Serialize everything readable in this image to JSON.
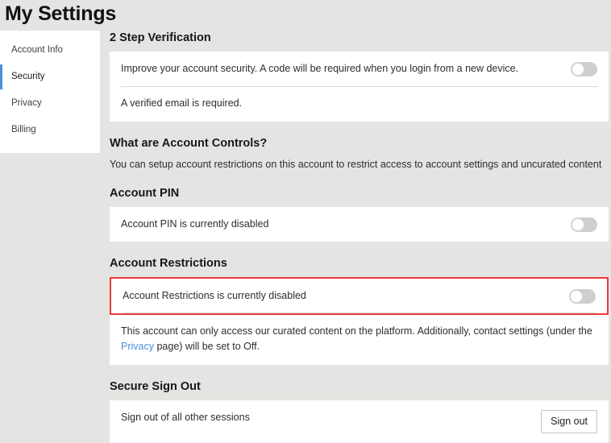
{
  "page": {
    "title": "My Settings",
    "background_color": "#e4e4e2",
    "accent_color": "#4a90d9",
    "highlight_color": "#ef3b3b"
  },
  "sidebar": {
    "items": [
      {
        "label": "Account Info",
        "active": false
      },
      {
        "label": "Security",
        "active": true
      },
      {
        "label": "Privacy",
        "active": false
      },
      {
        "label": "Billing",
        "active": false
      }
    ]
  },
  "sections": {
    "two_step": {
      "heading": "2 Step Verification",
      "row_text": "Improve your account security. A code will be required when you login from a new device.",
      "toggle_state": "off",
      "note": "A verified email is required."
    },
    "account_controls": {
      "heading": "What are Account Controls?",
      "description": "You can setup account restrictions on this account to restrict access to account settings and uncurated content"
    },
    "account_pin": {
      "heading": "Account PIN",
      "row_text": "Account PIN is currently disabled",
      "toggle_state": "off"
    },
    "account_restrictions": {
      "heading": "Account Restrictions",
      "row_text": "Account Restrictions is currently disabled",
      "toggle_state": "off",
      "note_before_link": "This account can only access our curated content on the platform. Additionally, contact settings (under the ",
      "note_link": "Privacy",
      "note_after_link": " page) will be set to Off.",
      "highlighted": true
    },
    "secure_sign_out": {
      "heading": "Secure Sign Out",
      "row_text": "Sign out of all other sessions",
      "button_label": "Sign out"
    }
  }
}
